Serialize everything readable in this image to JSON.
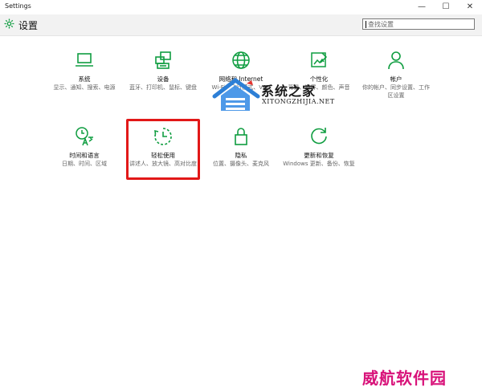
{
  "window": {
    "title": "Settings",
    "controls": {
      "minimize": "—",
      "maximize": "☐",
      "close": "✕"
    }
  },
  "header": {
    "title": "设置"
  },
  "search": {
    "placeholder": "查找设置"
  },
  "tiles": [
    {
      "key": "system",
      "name": "系统",
      "desc": "显示、通知、搜索、电源",
      "icon": "laptop-icon"
    },
    {
      "key": "devices",
      "name": "设备",
      "desc": "蓝牙、打印机、鼠标、键盘",
      "icon": "devices-icon"
    },
    {
      "key": "network",
      "name": "网络和 Internet",
      "desc": "Wi-Fi、飞行模式、VPN",
      "icon": "globe-icon"
    },
    {
      "key": "personalization",
      "name": "个性化",
      "desc": "背景、锁屏、颜色、声音",
      "icon": "personalization-icon"
    },
    {
      "key": "accounts",
      "name": "帐户",
      "desc": "你的帐户、同步设置、工作区设置",
      "icon": "person-icon"
    },
    {
      "key": "time",
      "name": "时间和语言",
      "desc": "日期、时间、区域",
      "icon": "time-language-icon"
    },
    {
      "key": "ease",
      "name": "轻松使用",
      "desc": "讲述人、放大镜、高对比度",
      "icon": "ease-of-access-icon"
    },
    {
      "key": "privacy",
      "name": "隐私",
      "desc": "位置、摄像头、麦克风",
      "icon": "lock-icon"
    },
    {
      "key": "update",
      "name": "更新和恢复",
      "desc": "Windows 更新、备份、恢复",
      "icon": "refresh-icon"
    }
  ],
  "watermarks": {
    "site_cn": "系统之家",
    "site_en": "XITONGZHIJIA.NET",
    "brand": "威航软件园"
  },
  "colors": {
    "accent": "#0f9d40",
    "highlight": "#e21818",
    "watermark_brand": "#d8137a"
  }
}
